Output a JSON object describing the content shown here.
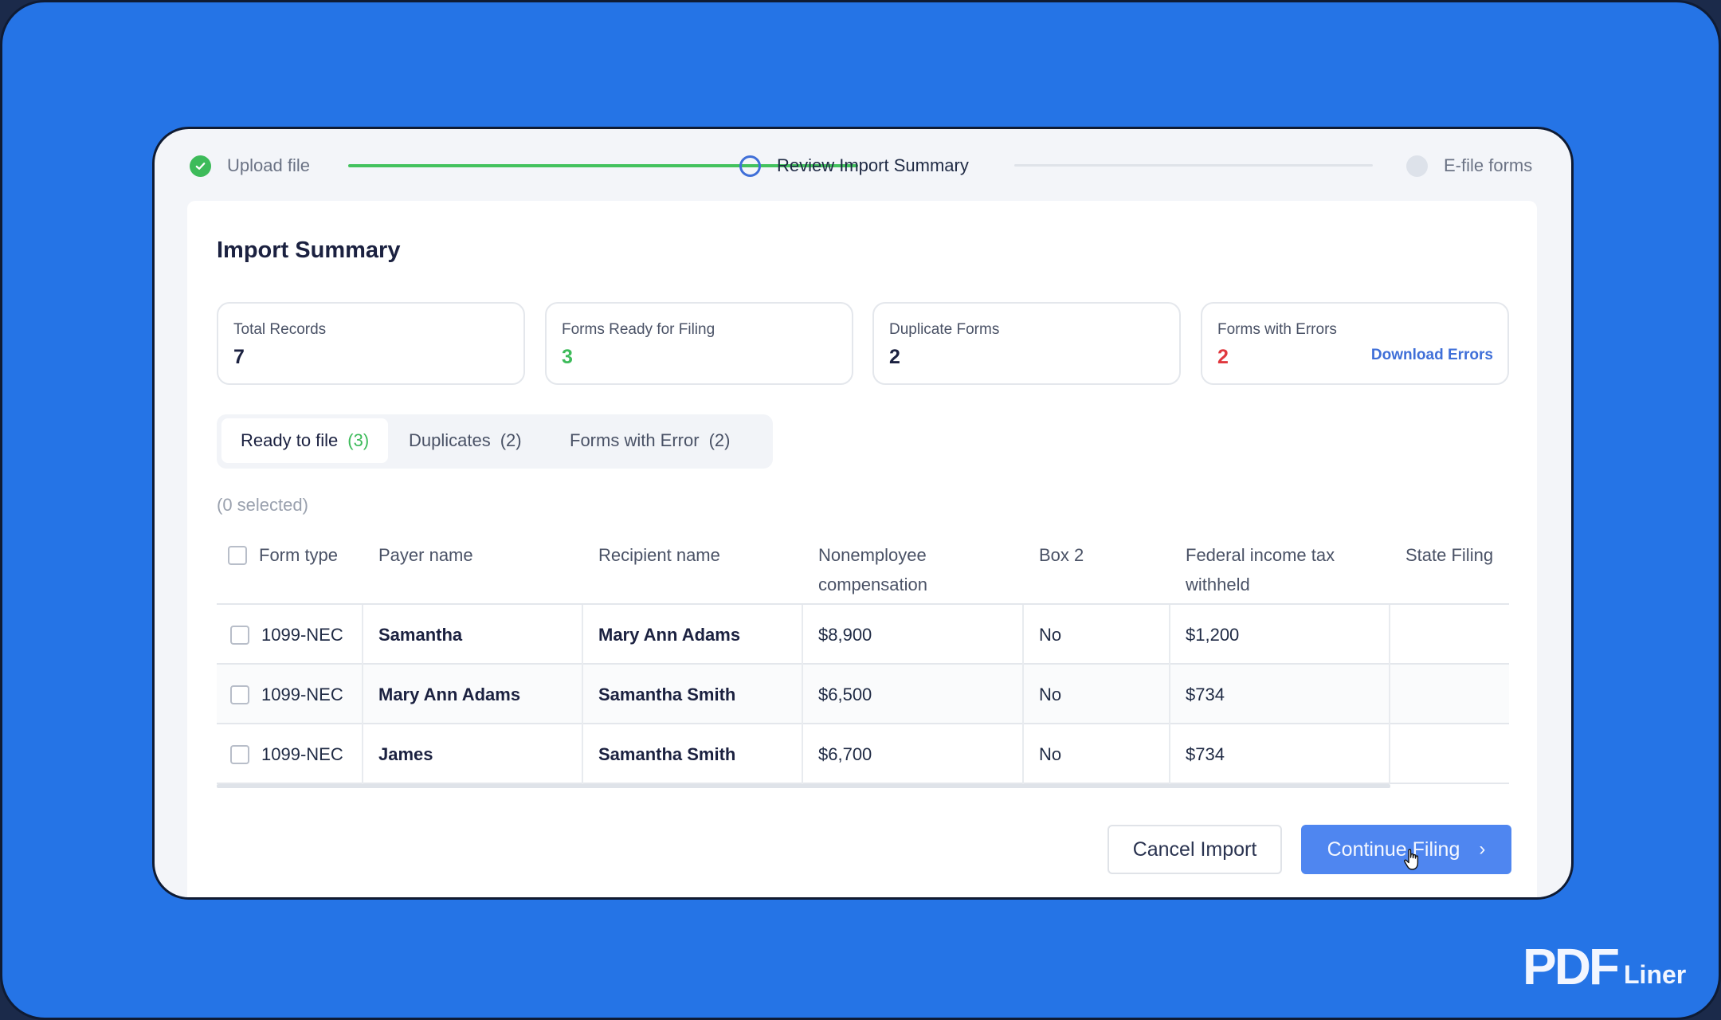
{
  "colors": {
    "background_blue": "#2574e6",
    "success_green": "#3dbb5a",
    "error_red": "#e0383e",
    "accent_blue": "#3f6fd8",
    "primary_button": "#4f86f0"
  },
  "stepper": {
    "steps": [
      {
        "label": "Upload file",
        "status": "completed",
        "icon": "check-circle-icon"
      },
      {
        "label": "Review Import Summary",
        "status": "current",
        "icon": "ring-icon"
      },
      {
        "label": "E-file forms",
        "status": "pending",
        "icon": "dot-icon"
      }
    ]
  },
  "page": {
    "title": "Import Summary"
  },
  "stats": [
    {
      "label": "Total Records",
      "value": "7"
    },
    {
      "label": "Forms Ready for Filing",
      "value": "3"
    },
    {
      "label": "Duplicate Forms",
      "value": "2"
    },
    {
      "label": "Forms with Errors",
      "value": "2",
      "link": "Download Errors"
    }
  ],
  "tabs": [
    {
      "label": "Ready to file",
      "count": "(3)",
      "active": true
    },
    {
      "label": "Duplicates",
      "count": "(2)",
      "active": false
    },
    {
      "label": "Forms with Error",
      "count": "(2)",
      "active": false
    }
  ],
  "table": {
    "selected_count": "(0 selected)",
    "columns": [
      "Form type",
      "Payer name",
      "Recipient name",
      "Nonemployee compensation",
      "Box 2",
      "Federal income tax withheld",
      "State Filing"
    ],
    "rows": [
      {
        "form_type": "1099-NEC",
        "payer": "Samantha",
        "recipient": "Mary Ann Adams",
        "compensation": "$8,900",
        "box2": "No",
        "federal_tax": "$1,200",
        "state_filing": ""
      },
      {
        "form_type": "1099-NEC",
        "payer": "Mary Ann Adams",
        "recipient": "Samantha Smith",
        "compensation": "$6,500",
        "box2": "No",
        "federal_tax": "$734",
        "state_filing": ""
      },
      {
        "form_type": "1099-NEC",
        "payer": "James",
        "recipient": "Samantha Smith",
        "compensation": "$6,700",
        "box2": "No",
        "federal_tax": "$734",
        "state_filing": ""
      }
    ]
  },
  "actions": {
    "cancel_label": "Cancel Import",
    "continue_label": "Continue Filing",
    "continue_icon": "chevron-right-icon"
  },
  "branding": {
    "logo_mark": "PDF",
    "logo_text": "Liner"
  }
}
